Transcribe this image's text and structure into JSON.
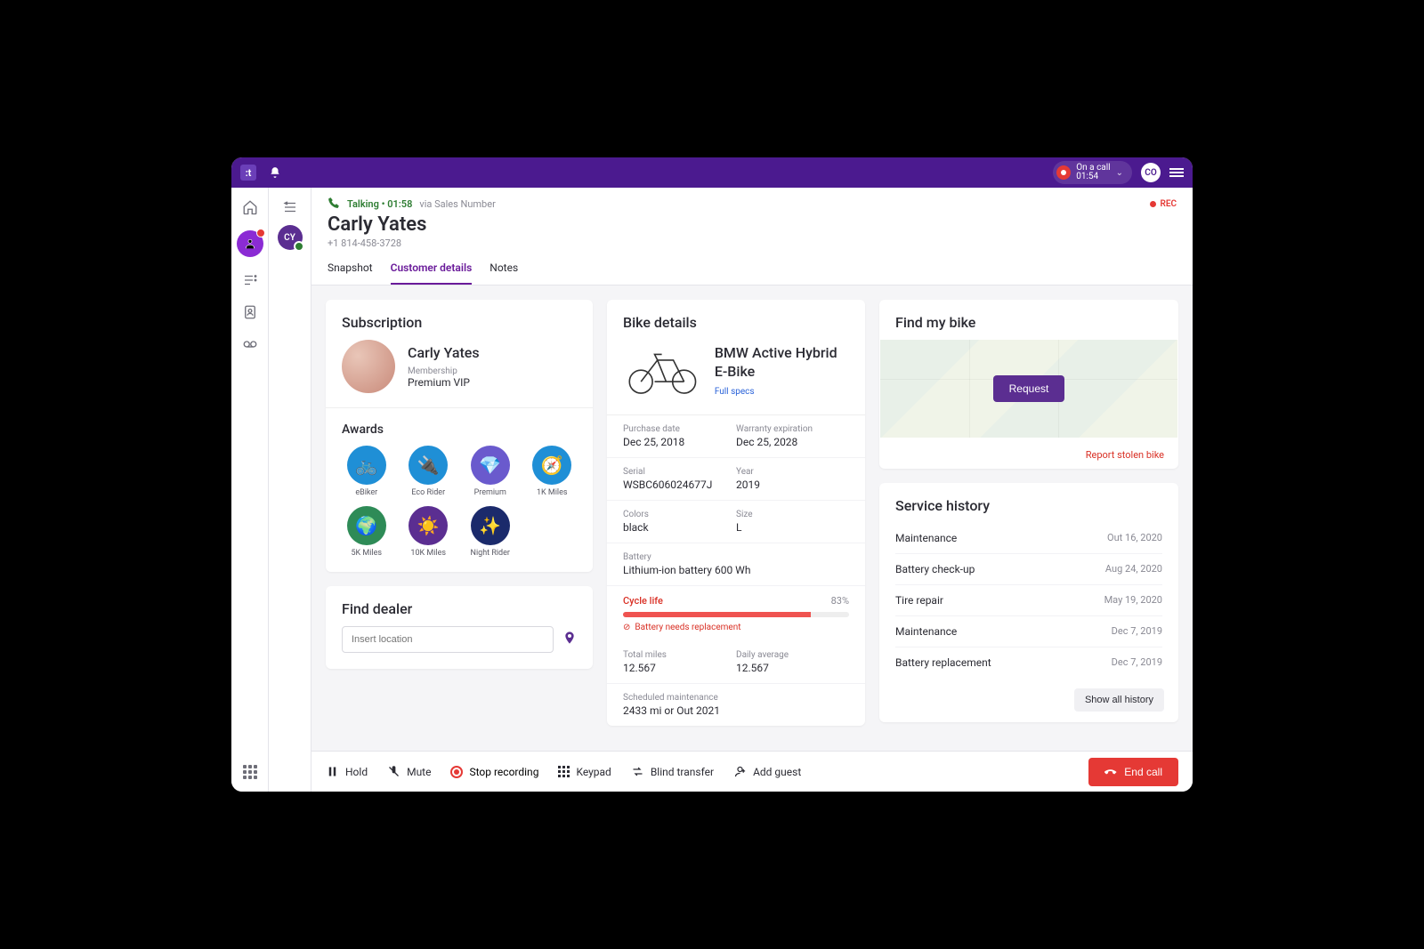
{
  "topbar": {
    "call_status_label": "On a call",
    "call_timer": "01:54",
    "user_initials": "CO"
  },
  "thread": {
    "initials": "CY"
  },
  "header": {
    "status_prefix": "Talking",
    "status_time": "01:58",
    "via": "via Sales Number",
    "contact_name": "Carly Yates",
    "contact_phone": "+1 814-458-3728",
    "rec": "REC"
  },
  "tabs": {
    "snapshot": "Snapshot",
    "customer_details": "Customer details",
    "notes": "Notes"
  },
  "subscription": {
    "title": "Subscription",
    "name": "Carly Yates",
    "membership_label": "Membership",
    "membership_value": "Premium VIP"
  },
  "awards": {
    "title": "Awards",
    "items": [
      {
        "label": "eBiker",
        "bg": "#1f8fd6",
        "emoji": "🚲"
      },
      {
        "label": "Eco Rider",
        "bg": "#1f8fd6",
        "emoji": "🔌"
      },
      {
        "label": "Premium",
        "bg": "#6a5acd",
        "emoji": "💎"
      },
      {
        "label": "1K Miles",
        "bg": "#1f8fd6",
        "emoji": "🧭"
      },
      {
        "label": "5K Miles",
        "bg": "#2e8b57",
        "emoji": "🌍"
      },
      {
        "label": "10K Miles",
        "bg": "#5b2e91",
        "emoji": "☀️"
      },
      {
        "label": "Night Rider",
        "bg": "#1b2a6b",
        "emoji": "✨"
      }
    ]
  },
  "dealer": {
    "title": "Find dealer",
    "placeholder": "Insert location"
  },
  "bike": {
    "title": "Bike details",
    "name": "BMW Active Hybrid E-Bike",
    "specs_link": "Full specs",
    "purchase_date_label": "Purchase date",
    "purchase_date": "Dec 25, 2018",
    "warranty_label": "Warranty expiration",
    "warranty": "Dec 25, 2028",
    "serial_label": "Serial",
    "serial": "WSBC606024677J",
    "year_label": "Year",
    "year": "2019",
    "colors_label": "Colors",
    "colors": "black",
    "size_label": "Size",
    "size": "L",
    "battery_label": "Battery",
    "battery": "Lithium-ion battery 600 Wh",
    "cycle_label": "Cycle life",
    "cycle_pct": "83%",
    "cycle_fill": 83,
    "battery_warning": "Battery needs replacement",
    "total_miles_label": "Total miles",
    "total_miles": "12.567",
    "daily_avg_label": "Daily average",
    "daily_avg": "12.567",
    "sched_label": "Scheduled maintenance",
    "sched": "2433 mi or Out 2021"
  },
  "findbike": {
    "title": "Find my bike",
    "request": "Request",
    "report": "Report stolen bike"
  },
  "history": {
    "title": "Service history",
    "items": [
      {
        "name": "Maintenance",
        "date": "Out 16, 2020"
      },
      {
        "name": "Battery check-up",
        "date": "Aug 24, 2020"
      },
      {
        "name": "Tire repair",
        "date": "May 19, 2020"
      },
      {
        "name": "Maintenance",
        "date": "Dec 7, 2019"
      },
      {
        "name": "Battery replacement",
        "date": "Dec 7, 2019"
      }
    ],
    "show_all": "Show all history"
  },
  "callbar": {
    "hold": "Hold",
    "mute": "Mute",
    "stop_rec": "Stop recording",
    "keypad": "Keypad",
    "blind_transfer": "Blind transfer",
    "add_guest": "Add guest",
    "end_call": "End call"
  }
}
